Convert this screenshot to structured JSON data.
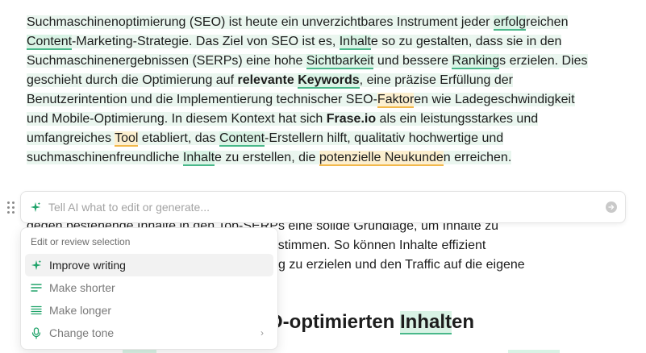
{
  "paragraph": {
    "segments": [
      {
        "t": "Suchmaschinenoptimierung (SEO) ist heute ein unverzichtbares Instrument jeder ",
        "s": ""
      },
      {
        "t": "erfolg",
        "s": "g"
      },
      {
        "t": "reichen ",
        "s": ""
      },
      {
        "t": "Content",
        "s": "g"
      },
      {
        "t": "-Marketing-Strategie. Das Ziel von SEO ist es, ",
        "s": ""
      },
      {
        "t": "Inhalt",
        "s": "g"
      },
      {
        "t": "e so zu gestalten, dass sie in den Suchmaschinenergebnissen (SERPs) eine hohe ",
        "s": ""
      },
      {
        "t": "Sichtbarkeit",
        "s": "g"
      },
      {
        "t": " und bessere ",
        "s": ""
      },
      {
        "t": "Ranking",
        "s": "g"
      },
      {
        "t": "s erzielen. Dies geschieht durch die Optimierung auf ",
        "s": ""
      },
      {
        "t": "relevante ",
        "s": "b"
      },
      {
        "t": "Keywords",
        "s": "bg"
      },
      {
        "t": ", eine präzise Erfüllung der Benutzerintention und die Implementierung technischer SEO-",
        "s": ""
      },
      {
        "t": "Faktor",
        "s": "y"
      },
      {
        "t": "en wie Ladegeschwindigkeit und Mobile-Optimierung. In diesem Kontext hat sich ",
        "s": ""
      },
      {
        "t": "Frase.io",
        "s": "b"
      },
      {
        "t": " als ein leistungsstarkes und umfangreiches ",
        "s": ""
      },
      {
        "t": "Tool",
        "s": "y"
      },
      {
        "t": " etabliert, das ",
        "s": ""
      },
      {
        "t": "Content",
        "s": "g"
      },
      {
        "t": "-Erstellern hilft, qualitativ hochwertige und suchmaschinenfreundliche ",
        "s": ""
      },
      {
        "t": "Inhalt",
        "s": "g"
      },
      {
        "t": "e zu erstellen, die ",
        "s": ""
      },
      {
        "t": "potenzielle Neukunde",
        "s": "y"
      },
      {
        "t": "n erreichen.",
        "s": ""
      }
    ]
  },
  "background_text": {
    "line1": "gegen bestehende Inhalte in den Top-SERPs eine solide Grundlage, um Inhalte zu",
    "line2": "abzustimmen. So können Inhalte effizient",
    "line3": "g zu erzielen und den Traffic auf die eigene",
    "heading_pre": "O-optimierten ",
    "heading_hl": "Inhalt",
    "heading_post": "en"
  },
  "prompt": {
    "placeholder": "Tell AI what to edit or generate..."
  },
  "menu": {
    "title": "Edit or review selection",
    "items": [
      {
        "label": "Improve writing",
        "icon": "sparkle-icon"
      },
      {
        "label": "Make shorter",
        "icon": "short-text-icon"
      },
      {
        "label": "Make longer",
        "icon": "long-text-icon"
      },
      {
        "label": "Change tone",
        "icon": "microphone-icon"
      }
    ]
  },
  "colors": {
    "accent": "#20a36a",
    "keyword_green": "#49b88a",
    "keyword_yellow": "#f2b84b",
    "selection_bg": "#eaf6ef"
  }
}
